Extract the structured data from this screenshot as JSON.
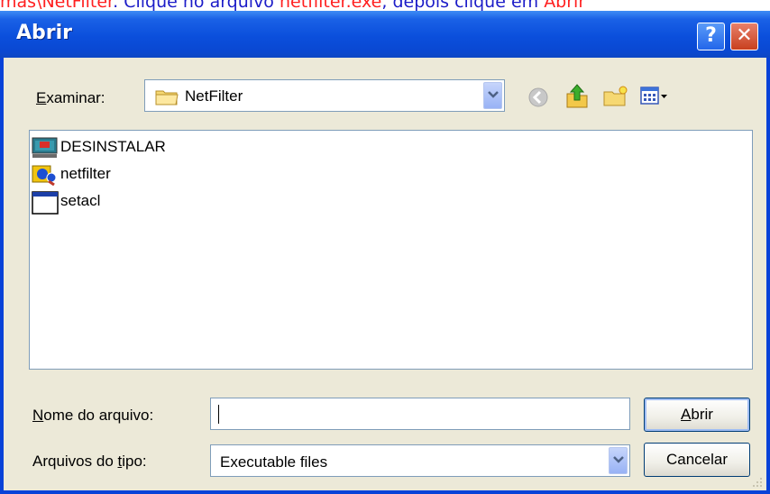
{
  "instruction": {
    "part1": "mas\\NetFilter",
    "part2": ". Clique no arquivo ",
    "part3": "netfilter.exe",
    "part4": ", depois clique em ",
    "part5": "Abrir"
  },
  "window": {
    "title": "Abrir",
    "help_label": "?",
    "close_label": "✕"
  },
  "look_in": {
    "label_accel": "E",
    "label_rest": "xaminar:",
    "value": "NetFilter",
    "folder_icon": "folder-icon"
  },
  "toolbar": {
    "icons": [
      "back-icon",
      "up-folder-icon",
      "new-folder-icon",
      "view-menu-icon"
    ]
  },
  "files": [
    {
      "name": "DESINSTALAR",
      "icon": "monitor-icon"
    },
    {
      "name": "netfilter",
      "icon": "netfilter-app-icon"
    },
    {
      "name": "setacl",
      "icon": "window-app-icon"
    }
  ],
  "filename": {
    "label_accel": "N",
    "label_rest": "ome do arquivo:",
    "value": ""
  },
  "filetype": {
    "label_pre": "Arquivos do ",
    "label_accel": "t",
    "label_post": "ipo:",
    "value": "Executable files"
  },
  "buttons": {
    "open_accel": "A",
    "open_rest": "brir",
    "cancel": "Cancelar"
  },
  "colors": {
    "title_bar": "#0b4fdc",
    "dialog_bg": "#ece9d8",
    "instruction_text": "#1c1cc8",
    "instruction_highlight": "#ff2020"
  }
}
